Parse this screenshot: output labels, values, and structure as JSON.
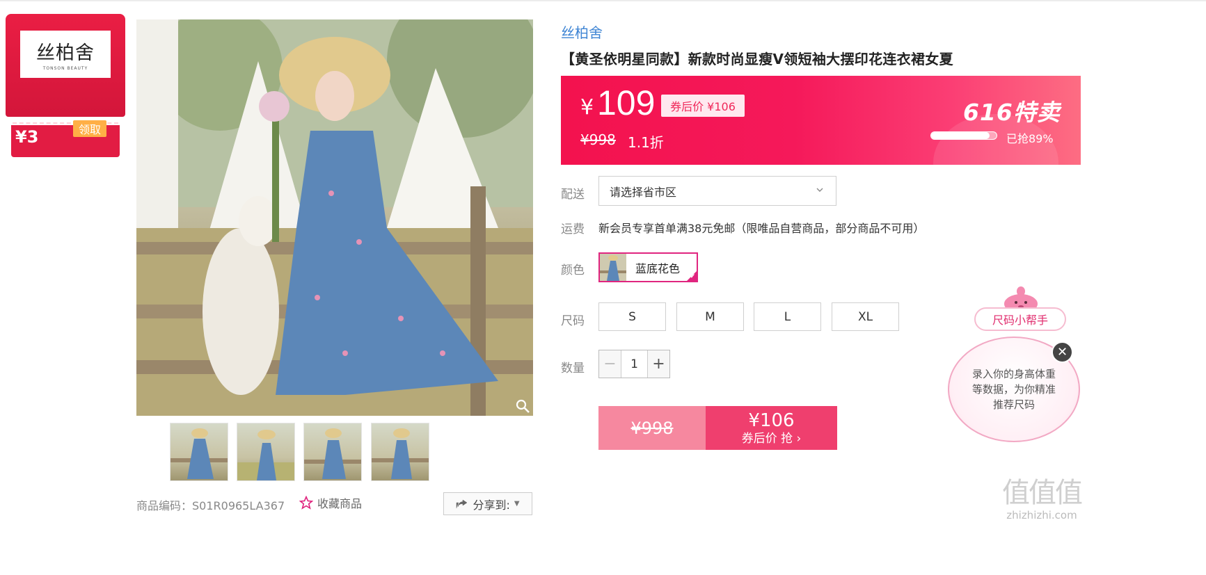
{
  "coupon": {
    "brand_logo_cn": "丝柏舍",
    "brand_logo_en": "TONSON BEAUTY",
    "amount": "¥3",
    "claim_label": "领取"
  },
  "gallery": {
    "thumbnail_count": 4,
    "sku_code": "商品编码：S01R0965LA367",
    "favorite_label": "收藏商品",
    "share_label": "分享到:"
  },
  "product": {
    "brand": "丝柏舍",
    "title": "【黄圣依明星同款】新款时尚显瘦V领短袖大摆印花连衣裙女夏"
  },
  "price": {
    "currency": "¥",
    "current": "109",
    "coupon_price": "券后价 ¥106",
    "original": "¥998",
    "discount": "1.1折",
    "promo_title": "616特卖",
    "sold_percent": 89,
    "sold_text": "已抢89%"
  },
  "delivery": {
    "label": "配送",
    "placeholder": "请选择省市区"
  },
  "shipping": {
    "label": "运费",
    "text": "新会员专享首单满38元免邮（限唯品自营商品，部分商品不可用）"
  },
  "color": {
    "label": "颜色",
    "selected": "蓝底花色"
  },
  "size": {
    "label": "尺码",
    "options": [
      "S",
      "M",
      "L",
      "XL"
    ]
  },
  "quantity": {
    "label": "数量",
    "value": "1",
    "minus": "−",
    "plus": "+"
  },
  "buy": {
    "original": "¥998",
    "price": "¥106",
    "action": "券后价 抢 ›"
  },
  "size_helper": {
    "title": "尺码小帮手",
    "text": "录入你的身高体重等数据，为你精准推荐尺码",
    "close": "✕"
  },
  "watermark": {
    "logo": "值值值",
    "site": "zhizhizhi.com"
  },
  "colors": {
    "accent": "#f3124e",
    "brand_blue": "#3f85d4",
    "coupon_red": "#e21c43",
    "select_pink": "#e0257f"
  }
}
